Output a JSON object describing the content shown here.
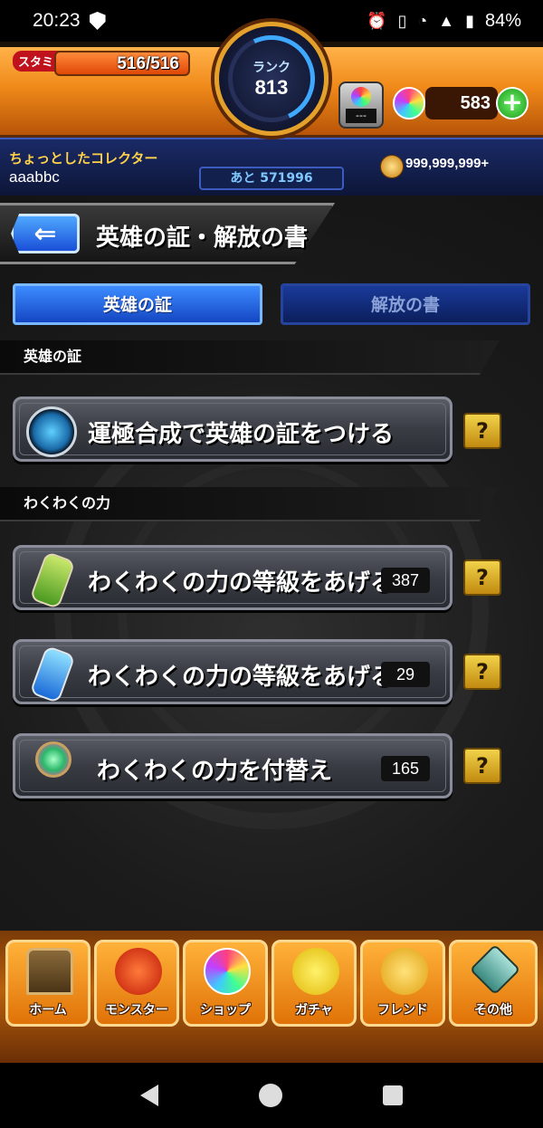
{
  "status_bar": {
    "time": "20:23",
    "battery": "84%",
    "icons": [
      "shield-icon",
      "alarm-icon",
      "vibrate-icon",
      "wifi-icon",
      "signal-icon",
      "battery-icon"
    ]
  },
  "header": {
    "stamina_label": "スタミナ",
    "stamina": "516/516",
    "stamina_fraction": 1.0,
    "rank_label": "ランク",
    "rank": "813",
    "rank_remaining": "あと 571996",
    "device_screen": "---",
    "orb_count": "583",
    "player_title": "ちょっとしたコレクター",
    "username": "aaabbc",
    "coins": "999,999,999+"
  },
  "page": {
    "title": "英雄の証・解放の書",
    "tabs": [
      {
        "label": "英雄の証",
        "active": true
      },
      {
        "label": "解放の書",
        "active": false
      }
    ]
  },
  "sections": [
    {
      "title": "英雄の証",
      "items": [
        {
          "label": "運極合成で英雄の証をつける",
          "icon": "hero-proof-icon",
          "count": ""
        }
      ]
    },
    {
      "title": "わくわくの力",
      "items": [
        {
          "label": "わくわくの力の等級をあげる",
          "icon": "green-potion-icon",
          "count": "387"
        },
        {
          "label": "わくわくの力の等級をあげる",
          "icon": "el-potion-icon",
          "count": "29"
        },
        {
          "label": "わくわくの力を付替え",
          "icon": "wand-icon",
          "count": "165"
        }
      ]
    }
  ],
  "help_label": "?",
  "bottom_nav": [
    {
      "label": "ホーム",
      "icon": "home-icon"
    },
    {
      "label": "モンスター",
      "icon": "monster-icon"
    },
    {
      "label": "ショップ",
      "icon": "orb-shop-icon"
    },
    {
      "label": "ガチャ",
      "icon": "gacha-icon"
    },
    {
      "label": "フレンド",
      "icon": "friend-icon"
    },
    {
      "label": "その他",
      "icon": "other-icon"
    }
  ],
  "colors": {
    "accent_orange": "#f08a1a",
    "accent_blue": "#1446c2",
    "help_yellow": "#f2d24a"
  }
}
